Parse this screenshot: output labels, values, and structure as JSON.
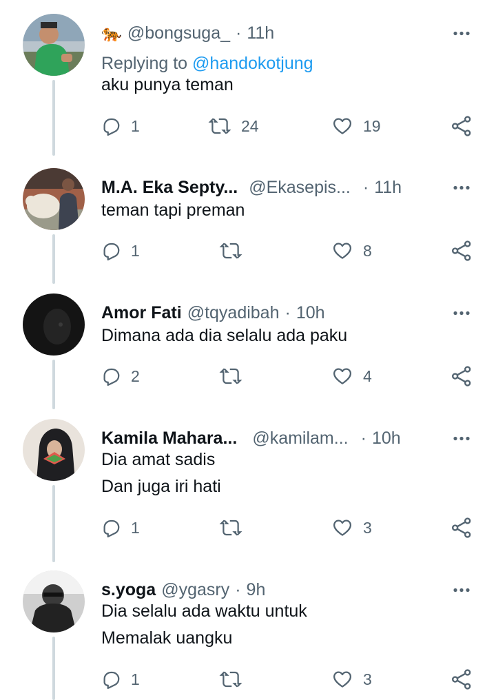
{
  "tweets": [
    {
      "name": "",
      "emoji": "🐅",
      "handle": "@bongsuga_",
      "time": "11h",
      "replying_prefix": "Replying to",
      "replying_to": "@handokotjung",
      "lines": [
        "aku punya teman"
      ],
      "replies": "1",
      "retweets": "24",
      "likes": "19"
    },
    {
      "name": "M.A. Eka Septy...",
      "handle": "@Ekasepis...",
      "time": "11h",
      "lines": [
        "teman tapi preman"
      ],
      "replies": "1",
      "retweets": "",
      "likes": "8"
    },
    {
      "name": "Amor Fati",
      "handle": "@tqyadibah",
      "time": "10h",
      "lines": [
        "Dimana ada dia selalu ada paku"
      ],
      "replies": "2",
      "retweets": "",
      "likes": "4"
    },
    {
      "name": "Kamila Mahara...",
      "handle": "@kamilam...",
      "time": "10h",
      "lines": [
        "Dia amat sadis",
        "Dan juga iri hati"
      ],
      "replies": "1",
      "retweets": "",
      "likes": "3"
    },
    {
      "name": "s.yoga",
      "handle": "@ygasry",
      "time": "9h",
      "lines": [
        "Dia selalu ada waktu untuk",
        "Memalak uangku"
      ],
      "replies": "1",
      "retweets": "",
      "likes": "3"
    }
  ],
  "separator": "·",
  "icons": {
    "reply": "reply-icon",
    "retweet": "retweet-icon",
    "like": "heart-icon",
    "share": "share-icon",
    "more": "more-icon"
  },
  "colors": {
    "text": "#0f1419",
    "muted": "#536471",
    "link": "#1d9bf0",
    "thread_line": "#cfd9de"
  }
}
